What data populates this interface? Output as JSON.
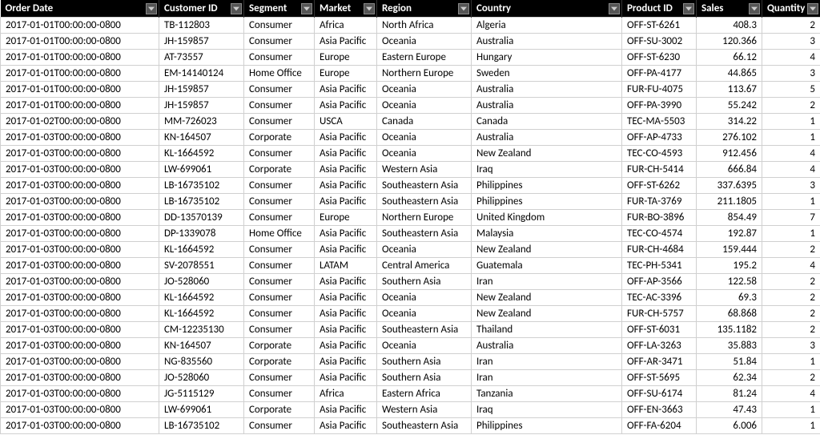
{
  "headers": {
    "orderdate": "Order Date",
    "customerid": "Customer ID",
    "segment": "Segment",
    "market": "Market",
    "region": "Region",
    "country": "Country",
    "productid": "Product ID",
    "sales": "Sales",
    "quantity": "Quantity"
  },
  "rows": [
    {
      "orderdate": "2017-01-01T00:00:00-0800",
      "customerid": "TB-112803",
      "segment": "Consumer",
      "market": "Africa",
      "region": "North Africa",
      "country": "Algeria",
      "productid": "OFF-ST-6261",
      "sales": "408.3",
      "quantity": "2"
    },
    {
      "orderdate": "2017-01-01T00:00:00-0800",
      "customerid": "JH-159857",
      "segment": "Consumer",
      "market": "Asia Pacific",
      "region": "Oceania",
      "country": "Australia",
      "productid": "OFF-SU-3002",
      "sales": "120.366",
      "quantity": "3"
    },
    {
      "orderdate": "2017-01-01T00:00:00-0800",
      "customerid": "AT-73557",
      "segment": "Consumer",
      "market": "Europe",
      "region": "Eastern Europe",
      "country": "Hungary",
      "productid": "OFF-ST-6230",
      "sales": "66.12",
      "quantity": "4"
    },
    {
      "orderdate": "2017-01-01T00:00:00-0800",
      "customerid": "EM-14140124",
      "segment": "Home Office",
      "market": "Europe",
      "region": "Northern Europe",
      "country": "Sweden",
      "productid": "OFF-PA-4177",
      "sales": "44.865",
      "quantity": "3"
    },
    {
      "orderdate": "2017-01-01T00:00:00-0800",
      "customerid": "JH-159857",
      "segment": "Consumer",
      "market": "Asia Pacific",
      "region": "Oceania",
      "country": "Australia",
      "productid": "FUR-FU-4075",
      "sales": "113.67",
      "quantity": "5"
    },
    {
      "orderdate": "2017-01-01T00:00:00-0800",
      "customerid": "JH-159857",
      "segment": "Consumer",
      "market": "Asia Pacific",
      "region": "Oceania",
      "country": "Australia",
      "productid": "OFF-PA-3990",
      "sales": "55.242",
      "quantity": "2"
    },
    {
      "orderdate": "2017-01-02T00:00:00-0800",
      "customerid": "MM-726023",
      "segment": "Consumer",
      "market": "USCA",
      "region": "Canada",
      "country": "Canada",
      "productid": "TEC-MA-5503",
      "sales": "314.22",
      "quantity": "1"
    },
    {
      "orderdate": "2017-01-03T00:00:00-0800",
      "customerid": "KN-164507",
      "segment": "Corporate",
      "market": "Asia Pacific",
      "region": "Oceania",
      "country": "Australia",
      "productid": "OFF-AP-4733",
      "sales": "276.102",
      "quantity": "1"
    },
    {
      "orderdate": "2017-01-03T00:00:00-0800",
      "customerid": "KL-1664592",
      "segment": "Consumer",
      "market": "Asia Pacific",
      "region": "Oceania",
      "country": "New Zealand",
      "productid": "TEC-CO-4593",
      "sales": "912.456",
      "quantity": "4"
    },
    {
      "orderdate": "2017-01-03T00:00:00-0800",
      "customerid": "LW-699061",
      "segment": "Corporate",
      "market": "Asia Pacific",
      "region": "Western Asia",
      "country": "Iraq",
      "productid": "FUR-CH-5414",
      "sales": "666.84",
      "quantity": "4"
    },
    {
      "orderdate": "2017-01-03T00:00:00-0800",
      "customerid": "LB-16735102",
      "segment": "Consumer",
      "market": "Asia Pacific",
      "region": "Southeastern Asia",
      "country": "Philippines",
      "productid": "OFF-ST-6262",
      "sales": "337.6395",
      "quantity": "3"
    },
    {
      "orderdate": "2017-01-03T00:00:00-0800",
      "customerid": "LB-16735102",
      "segment": "Consumer",
      "market": "Asia Pacific",
      "region": "Southeastern Asia",
      "country": "Philippines",
      "productid": "FUR-TA-3769",
      "sales": "211.1805",
      "quantity": "1"
    },
    {
      "orderdate": "2017-01-03T00:00:00-0800",
      "customerid": "DD-13570139",
      "segment": "Consumer",
      "market": "Europe",
      "region": "Northern Europe",
      "country": "United Kingdom",
      "productid": "FUR-BO-3896",
      "sales": "854.49",
      "quantity": "7"
    },
    {
      "orderdate": "2017-01-03T00:00:00-0800",
      "customerid": "DP-1339078",
      "segment": "Home Office",
      "market": "Asia Pacific",
      "region": "Southeastern Asia",
      "country": "Malaysia",
      "productid": "TEC-CO-4574",
      "sales": "192.87",
      "quantity": "1"
    },
    {
      "orderdate": "2017-01-03T00:00:00-0800",
      "customerid": "KL-1664592",
      "segment": "Consumer",
      "market": "Asia Pacific",
      "region": "Oceania",
      "country": "New Zealand",
      "productid": "FUR-CH-4684",
      "sales": "159.444",
      "quantity": "2"
    },
    {
      "orderdate": "2017-01-03T00:00:00-0800",
      "customerid": "SV-2078551",
      "segment": "Consumer",
      "market": "LATAM",
      "region": "Central America",
      "country": "Guatemala",
      "productid": "TEC-PH-5341",
      "sales": "195.2",
      "quantity": "4"
    },
    {
      "orderdate": "2017-01-03T00:00:00-0800",
      "customerid": "JO-528060",
      "segment": "Consumer",
      "market": "Asia Pacific",
      "region": "Southern Asia",
      "country": "Iran",
      "productid": "OFF-AP-3566",
      "sales": "122.58",
      "quantity": "2"
    },
    {
      "orderdate": "2017-01-03T00:00:00-0800",
      "customerid": "KL-1664592",
      "segment": "Consumer",
      "market": "Asia Pacific",
      "region": "Oceania",
      "country": "New Zealand",
      "productid": "TEC-AC-3396",
      "sales": "69.3",
      "quantity": "2"
    },
    {
      "orderdate": "2017-01-03T00:00:00-0800",
      "customerid": "KL-1664592",
      "segment": "Consumer",
      "market": "Asia Pacific",
      "region": "Oceania",
      "country": "New Zealand",
      "productid": "FUR-CH-5757",
      "sales": "68.868",
      "quantity": "2"
    },
    {
      "orderdate": "2017-01-03T00:00:00-0800",
      "customerid": "CM-12235130",
      "segment": "Consumer",
      "market": "Asia Pacific",
      "region": "Southeastern Asia",
      "country": "Thailand",
      "productid": "OFF-ST-6031",
      "sales": "135.1182",
      "quantity": "2"
    },
    {
      "orderdate": "2017-01-03T00:00:00-0800",
      "customerid": "KN-164507",
      "segment": "Corporate",
      "market": "Asia Pacific",
      "region": "Oceania",
      "country": "Australia",
      "productid": "OFF-LA-3263",
      "sales": "35.883",
      "quantity": "3"
    },
    {
      "orderdate": "2017-01-03T00:00:00-0800",
      "customerid": "NG-835560",
      "segment": "Corporate",
      "market": "Asia Pacific",
      "region": "Southern Asia",
      "country": "Iran",
      "productid": "OFF-AR-3471",
      "sales": "51.84",
      "quantity": "1"
    },
    {
      "orderdate": "2017-01-03T00:00:00-0800",
      "customerid": "JO-528060",
      "segment": "Consumer",
      "market": "Asia Pacific",
      "region": "Southern Asia",
      "country": "Iran",
      "productid": "OFF-ST-5695",
      "sales": "62.34",
      "quantity": "2"
    },
    {
      "orderdate": "2017-01-03T00:00:00-0800",
      "customerid": "JG-5115129",
      "segment": "Consumer",
      "market": "Africa",
      "region": "Eastern Africa",
      "country": "Tanzania",
      "productid": "OFF-SU-6174",
      "sales": "81.24",
      "quantity": "4"
    },
    {
      "orderdate": "2017-01-03T00:00:00-0800",
      "customerid": "LW-699061",
      "segment": "Corporate",
      "market": "Asia Pacific",
      "region": "Western Asia",
      "country": "Iraq",
      "productid": "OFF-EN-3663",
      "sales": "47.43",
      "quantity": "1"
    },
    {
      "orderdate": "2017-01-03T00:00:00-0800",
      "customerid": "LB-16735102",
      "segment": "Consumer",
      "market": "Asia Pacific",
      "region": "Southeastern Asia",
      "country": "Philippines",
      "productid": "OFF-FA-6204",
      "sales": "6.006",
      "quantity": "1"
    }
  ]
}
